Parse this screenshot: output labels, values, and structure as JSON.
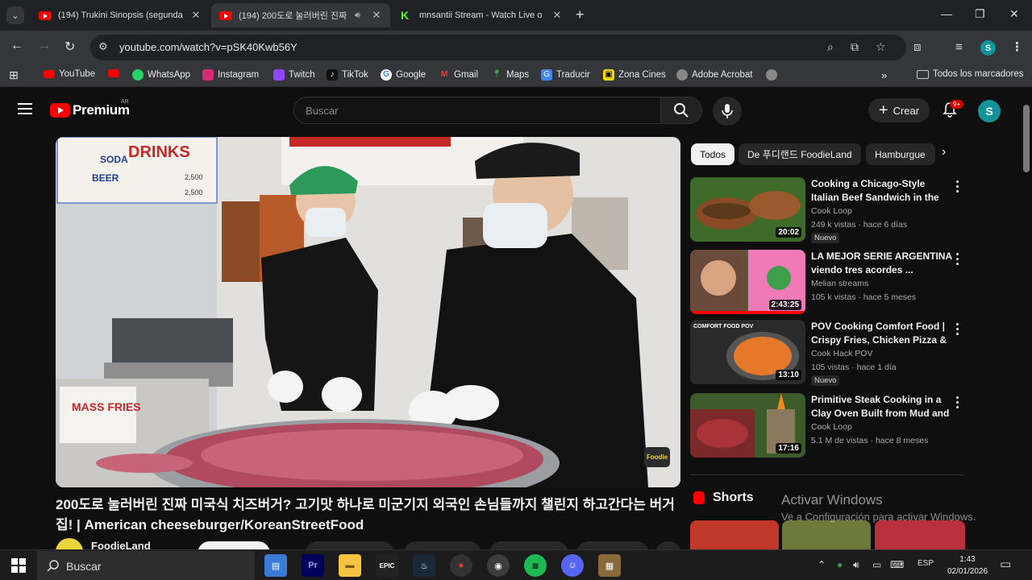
{
  "browser": {
    "tabs": [
      {
        "title": "(194) Trukini Sinopsis (segunda",
        "active": false
      },
      {
        "title": "(194) 200도로 눌러버린 진짜",
        "active": true
      },
      {
        "title": "mnsantii Stream - Watch Live o",
        "active": false
      }
    ],
    "url": "youtube.com/watch?v=pSK40Kwb56Y",
    "bookmarks": [
      "YouTube",
      "",
      "WhatsApp",
      "Instagram",
      "Twitch",
      "TikTok",
      "Google",
      "Gmail",
      "Maps",
      "Traducir",
      "Zona Cines",
      "Adobe Acrobat",
      ""
    ],
    "all_bookmarks": "Todos los marcadores",
    "profile_initial": "S"
  },
  "youtube": {
    "logo": "Premium",
    "region": "AR",
    "search_placeholder": "Buscar",
    "create_label": "Crear",
    "notification_badge": "9+",
    "avatar_initial": "S"
  },
  "video": {
    "title": "200도로 눌러버린 진짜 미국식 치즈버거? 고기맛 하나로 미군기지 외국인 손님들까지 챌린지 하고간다는 버거집! | American cheeseburger/KoreanStreetFood",
    "channel": "FoodieLand",
    "overlay_signs": {
      "drinks": "DRINKS",
      "soda": "SODA",
      "beer": "BEER",
      "price1": "2,500",
      "price2": "2,500",
      "mass_fries": "MASS FRIES",
      "foodie": "Foodie"
    }
  },
  "chips": [
    "Todos",
    "De 푸디랜드 FoodieLand",
    "Hamburgue"
  ],
  "recommendations": [
    {
      "title": "Cooking a Chicago-Style Italian Beef Sandwich in the Wild | ...",
      "channel": "Cook Loop",
      "meta": "249 k vistas · hace 6 días",
      "duration": "20:02",
      "badge": "Nuevo"
    },
    {
      "title": "LA MEJOR SERIE ARGENTINA viendo tres acordes ...",
      "channel": "Melian streams",
      "meta": "105 k vistas · hace 5 meses",
      "duration": "2:43:25",
      "badge": ""
    },
    {
      "title": "POV Cooking Comfort Food | Crispy Fries, Chicken Pizza & ...",
      "channel": "Cook Hack POV",
      "meta": "105 vistas · hace 1 día",
      "duration": "13:10",
      "badge": "Nuevo",
      "thumb_text": "COMFORT FOOD POV"
    },
    {
      "title": "Primitive Steak Cooking in a Clay Oven Built from Mud and ...",
      "channel": "Cook Loop",
      "meta": "5.1 M de vistas · hace 8 meses",
      "duration": "17:16",
      "badge": ""
    }
  ],
  "shorts_label": "Shorts",
  "watermark": {
    "line1": "Activar Windows",
    "line2": "Ve a Configuración para activar Windows."
  },
  "taskbar": {
    "search": "Buscar",
    "lang": "ESP",
    "time": "1:43",
    "date": "02/01/2026"
  }
}
